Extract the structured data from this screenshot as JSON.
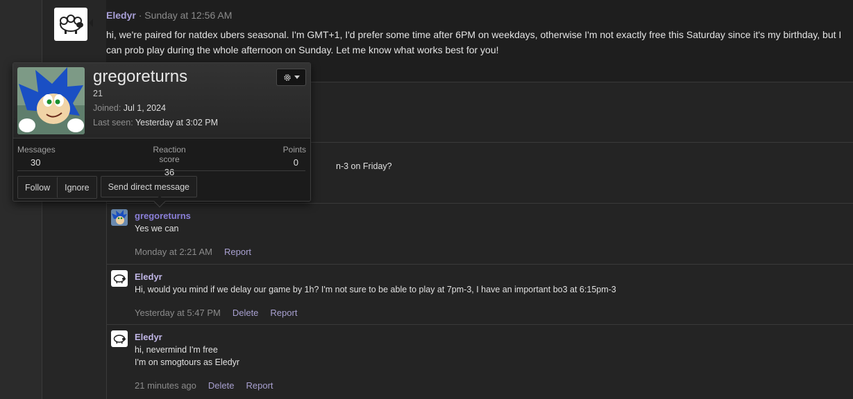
{
  "main_post": {
    "author": "Eledyr",
    "separator": "·",
    "time": "Sunday at 12:56 AM",
    "body": "hi, we're paired for natdex ubers seasonal. I'm GMT+1, I'd prefer some time after 6PM on weekdays, otherwise I'm not exactly free this Saturday since it's my birthday, but I can prob play during the whole afternoon on Sunday. Let me know what works best for you!"
  },
  "hidden_comment_fragment": "n-3 on Friday?",
  "comments": [
    {
      "author": "gregoreturns",
      "text": "Yes we can",
      "time": "Monday at 2:21 AM",
      "actions": [
        "Report"
      ]
    },
    {
      "author": "Eledyr",
      "text": "Hi, would you mind if we delay our game by 1h? I'm not sure to be able to play at 7pm-3, I have an important bo3 at 6:15pm-3",
      "time": "Yesterday at 5:47 PM",
      "actions": [
        "Delete",
        "Report"
      ]
    },
    {
      "author": "Eledyr",
      "text_lines": [
        "hi, nevermind I'm free",
        "I'm on smogtours as Eledyr"
      ],
      "time": "21 minutes ago",
      "actions": [
        "Delete",
        "Report"
      ]
    }
  ],
  "member_popup": {
    "name": "gregoreturns",
    "age": "21",
    "joined_label": "Joined:",
    "joined_value": "Jul 1, 2024",
    "last_seen_label": "Last seen:",
    "last_seen_value": "Yesterday at 3:02 PM",
    "gear_icon": "gear-icon",
    "stats": [
      {
        "label": "Messages",
        "value": "30"
      },
      {
        "label": "Reaction score",
        "value": "36"
      },
      {
        "label": "Points",
        "value": "0"
      }
    ],
    "buttons": {
      "follow": "Follow",
      "ignore": "Ignore",
      "message": "Send direct message"
    }
  },
  "colors": {
    "author_link": "#a9a0d8",
    "action_link": "#a8a0d0",
    "background": "#1e1e1e"
  }
}
